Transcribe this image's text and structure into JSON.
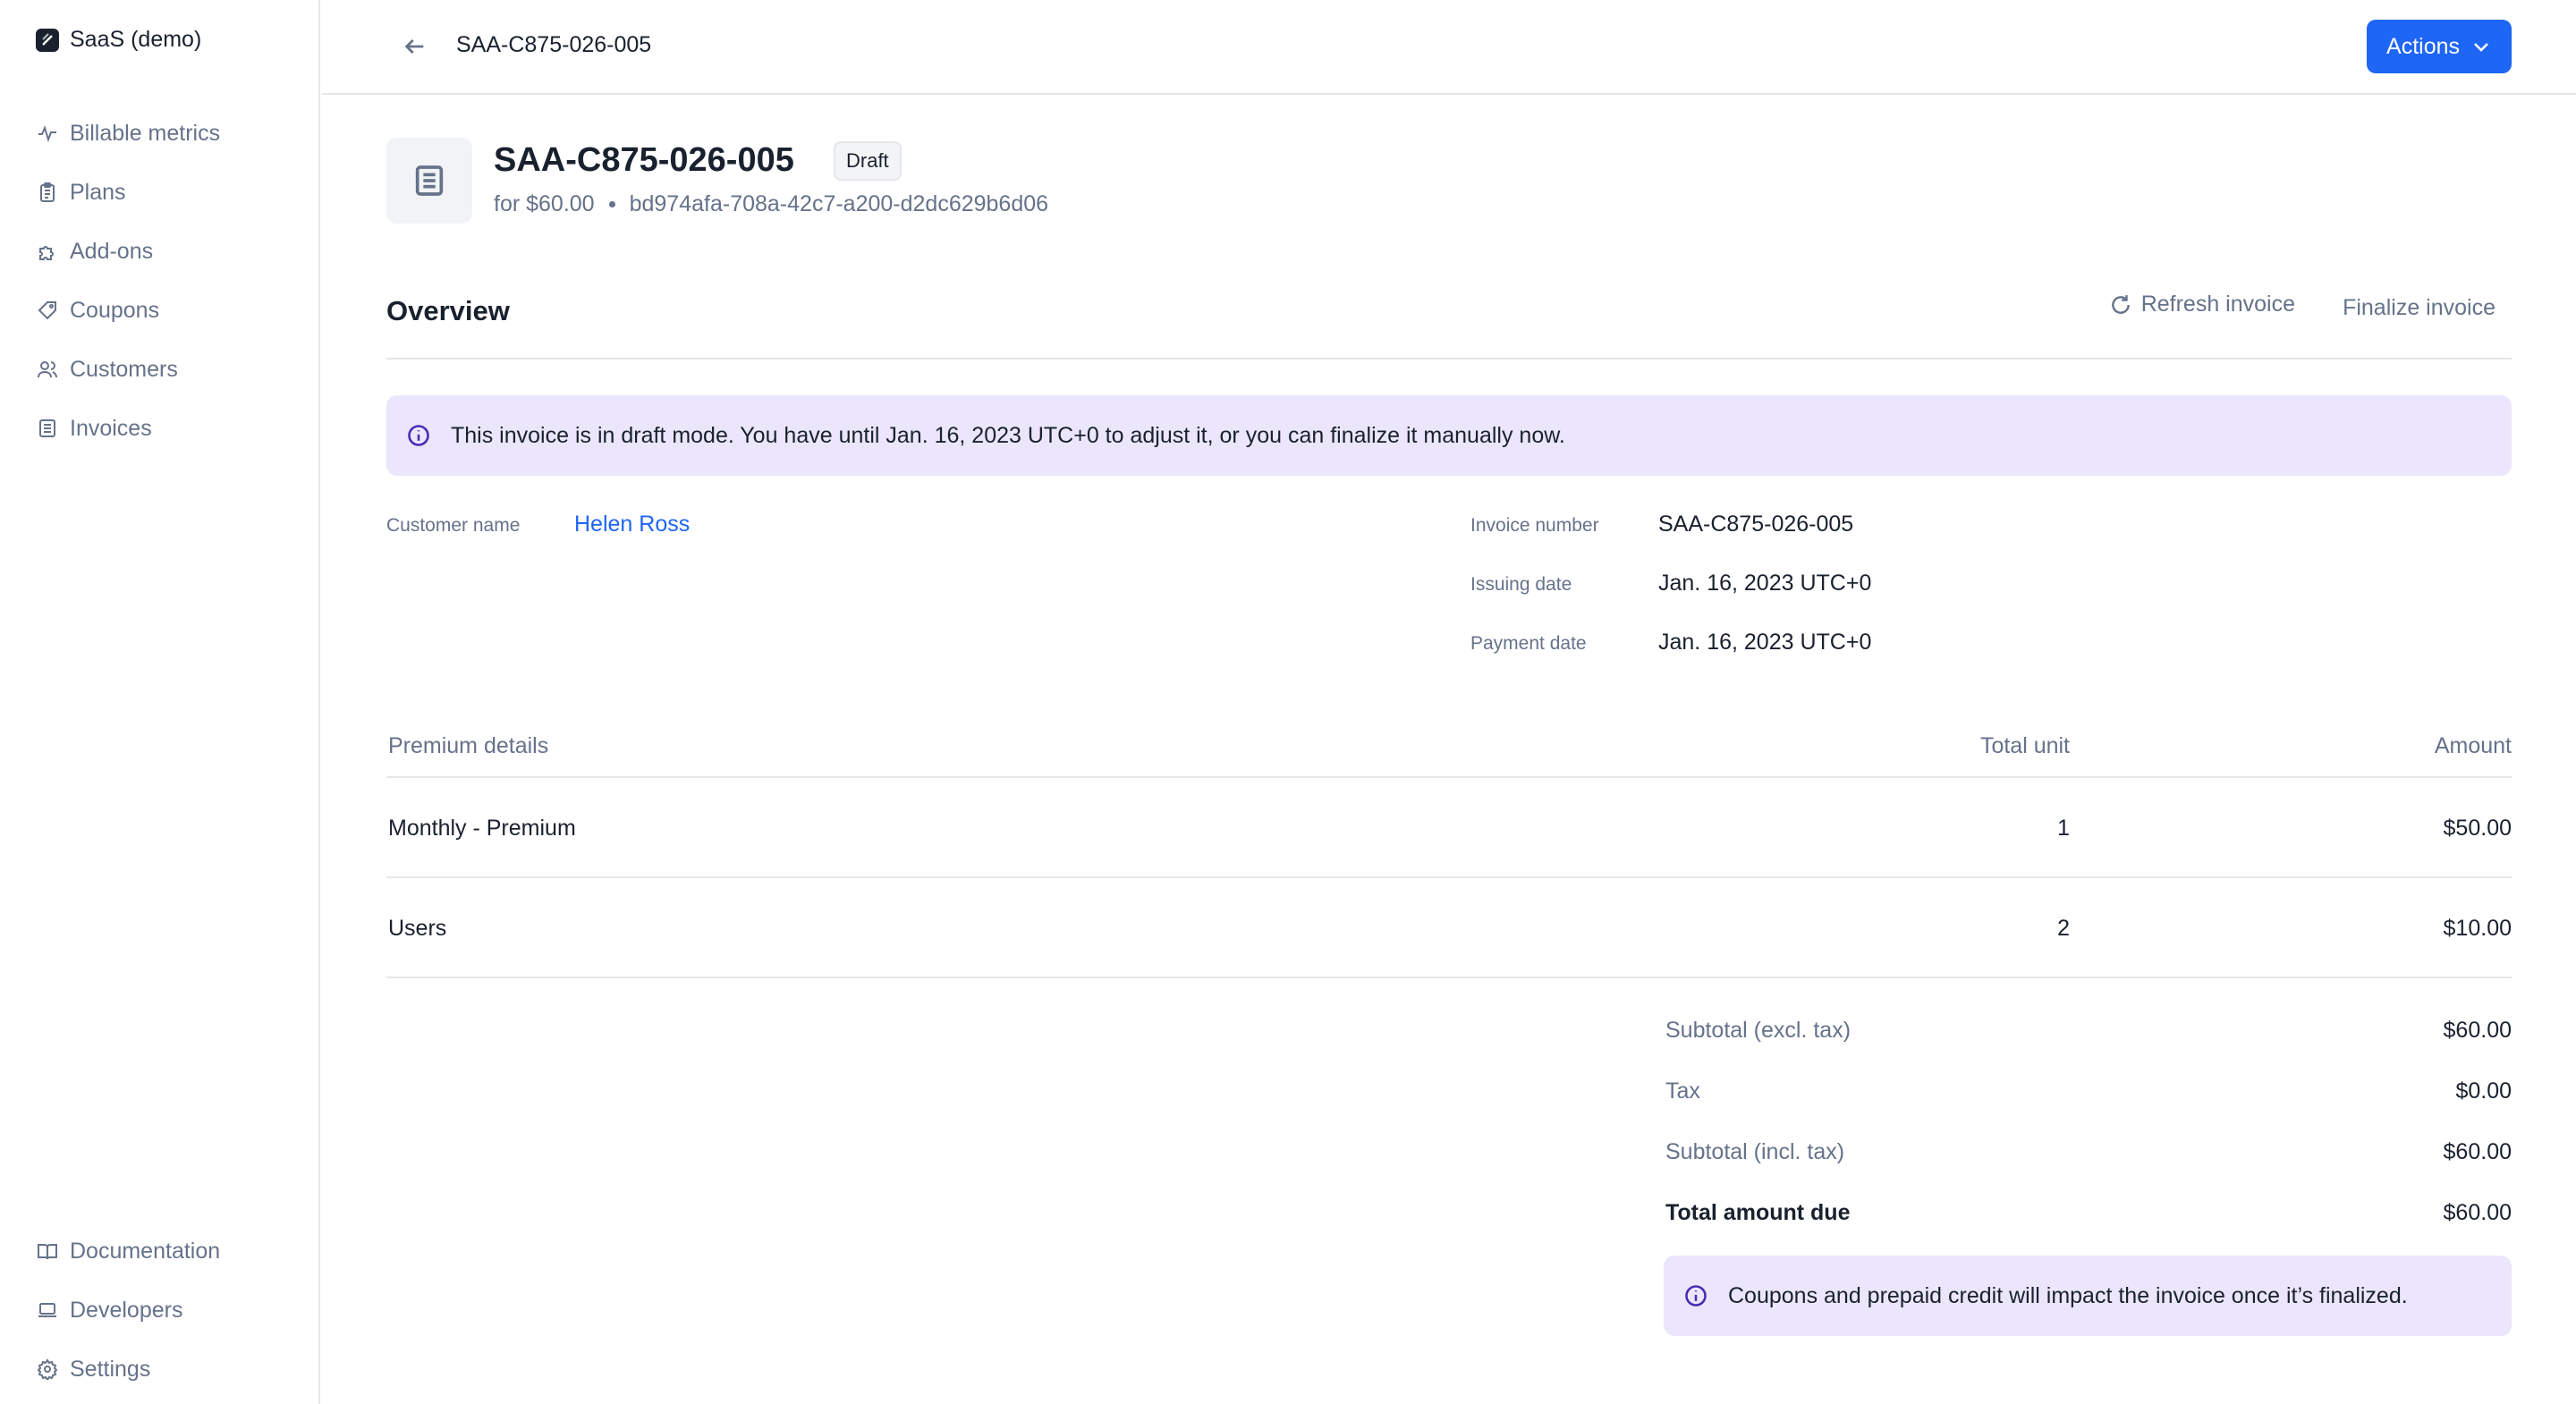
{
  "sidebar": {
    "org_name": "SaaS (demo)",
    "items": [
      {
        "label": "Billable metrics",
        "icon": "pulse-icon"
      },
      {
        "label": "Plans",
        "icon": "clipboard-icon"
      },
      {
        "label": "Add-ons",
        "icon": "puzzle-icon"
      },
      {
        "label": "Coupons",
        "icon": "tag-icon"
      },
      {
        "label": "Customers",
        "icon": "users-icon"
      },
      {
        "label": "Invoices",
        "icon": "document-icon"
      }
    ],
    "bottom_items": [
      {
        "label": "Documentation",
        "icon": "book-icon"
      },
      {
        "label": "Developers",
        "icon": "laptop-icon"
      },
      {
        "label": "Settings",
        "icon": "gear-icon"
      }
    ]
  },
  "header": {
    "title": "SAA-C875-026-005",
    "actions_label": "Actions"
  },
  "invoice": {
    "number": "SAA-C875-026-005",
    "status": "Draft",
    "amount_text": "for $60.00",
    "id": "bd974afa-708a-42c7-a200-d2dc629b6d06"
  },
  "overview": {
    "title": "Overview",
    "refresh_label": "Refresh invoice",
    "finalize_label": "Finalize invoice",
    "draft_notice": "This invoice is in draft mode. You have until Jan. 16, 2023 UTC+0 to adjust it, or you can finalize it manually now."
  },
  "details": {
    "customer_label": "Customer name",
    "customer_value": "Helen Ross",
    "invoice_number_label": "Invoice number",
    "invoice_number_value": "SAA-C875-026-005",
    "issuing_date_label": "Issuing date",
    "issuing_date_value": "Jan. 16, 2023 UTC+0",
    "payment_date_label": "Payment date",
    "payment_date_value": "Jan. 16, 2023 UTC+0"
  },
  "table": {
    "headers": [
      "Premium details",
      "Total unit",
      "Amount"
    ],
    "rows": [
      {
        "name": "Monthly - Premium",
        "units": "1",
        "amount": "$50.00"
      },
      {
        "name": "Users",
        "units": "2",
        "amount": "$10.00"
      }
    ]
  },
  "totals": [
    {
      "label": "Subtotal (excl. tax)",
      "value": "$60.00"
    },
    {
      "label": "Tax",
      "value": "$0.00"
    },
    {
      "label": "Subtotal (incl. tax)",
      "value": "$60.00"
    },
    {
      "label": "Total amount due",
      "value": "$60.00"
    }
  ],
  "coupon_notice": "Coupons and prepaid credit will impact the invoice once it’s finalized.",
  "colors": {
    "accent": "#1e66f5",
    "notice_bg": "#ebe6fb",
    "text": "#19212e",
    "muted": "#66728a"
  }
}
